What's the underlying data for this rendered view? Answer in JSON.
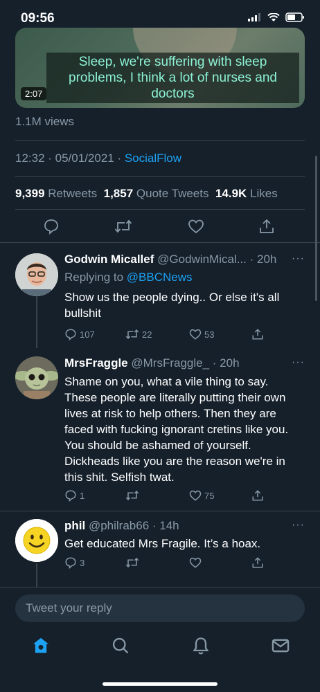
{
  "status_bar": {
    "time": "09:56"
  },
  "media": {
    "caption": "Sleep, we're suffering with sleep problems, I think a lot of nurses and doctors",
    "duration": "2:07"
  },
  "tweet": {
    "views": "1.1M views",
    "date": "12:32 · 05/01/2021 · ",
    "source": "SocialFlow",
    "retweets_count": "9,399",
    "retweets_label": "Retweets",
    "quotes_count": "1,857",
    "quotes_label": "Quote Tweets",
    "likes_count": "14.9K",
    "likes_label": "Likes"
  },
  "replies": [
    {
      "name": "Godwin Micallef",
      "handle": "@GodwinMical...",
      "time": "· 20h",
      "replying_prefix": "Replying to ",
      "replying_to": "@BBCNews",
      "text": "Show us the people dying.. Or else it's all bullshit",
      "reply_count": "107",
      "retweet_count": "22",
      "like_count": "53"
    },
    {
      "name": "MrsFraggle",
      "handle": "@MrsFraggle_",
      "time": "· 20h",
      "text": "Shame on you, what a vile thing to say. These people are literally putting their own lives at risk to help others. Then they are faced with fucking ignorant cretins like you. You should be ashamed of yourself. Dickheads like you are the reason we're in this shit. Selfish twat.",
      "reply_count": "1",
      "retweet_count": "",
      "like_count": "75"
    },
    {
      "name": "phil",
      "handle": "@philrab66",
      "time": "· 14h",
      "text": "Get educated Mrs Fragile. It’s a hoax.",
      "reply_count": "3",
      "retweet_count": "",
      "like_count": ""
    }
  ],
  "more_label": "···",
  "composer": {
    "placeholder": "Tweet your reply"
  },
  "tabs": [
    "home-icon",
    "search-icon",
    "notifications-icon",
    "messages-icon"
  ],
  "colors": {
    "background": "#15202b",
    "accent": "#1da1f2",
    "muted": "#8899a6",
    "caption": "#8cf2d5"
  }
}
